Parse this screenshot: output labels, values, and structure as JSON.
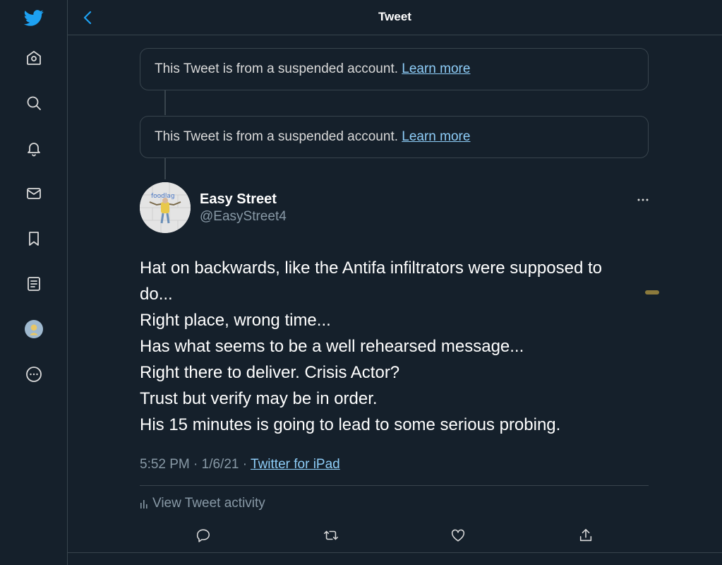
{
  "header": {
    "title": "Tweet"
  },
  "sidebar": {
    "items": [
      {
        "icon": "twitter-bird-icon"
      },
      {
        "icon": "home-icon"
      },
      {
        "icon": "search-icon"
      },
      {
        "icon": "bell-icon"
      },
      {
        "icon": "mail-icon"
      },
      {
        "icon": "bookmark-icon"
      },
      {
        "icon": "list-icon"
      },
      {
        "icon": "profile-avatar"
      },
      {
        "icon": "more-icon"
      }
    ]
  },
  "suspended_notices": [
    {
      "text": "This Tweet is from a suspended account. ",
      "link": "Learn more"
    },
    {
      "text": "This Tweet is from a suspended account. ",
      "link": "Learn more"
    }
  ],
  "tweet": {
    "display_name": "Easy Street",
    "handle": "@EasyStreet4",
    "avatar_text": "foodlag",
    "lines": [
      "Hat on backwards, like the Antifa infiltrators were supposed to",
      "do...",
      "Right place, wrong time...",
      "Has what seems to be a well rehearsed message...",
      "Right there to deliver. Crisis Actor?",
      "Trust but verify may be in order.",
      "His 15 minutes is going to lead to some serious probing."
    ],
    "timestamp": "5:52 PM · 1/6/21 · ",
    "source": "Twitter for iPad",
    "activity_label": "View Tweet activity"
  },
  "actions": [
    {
      "icon": "reply-icon"
    },
    {
      "icon": "retweet-icon"
    },
    {
      "icon": "like-icon"
    },
    {
      "icon": "share-icon"
    }
  ],
  "colors": {
    "background": "#15202b",
    "border": "#38444d",
    "link": "#8ecdf8",
    "secondary_text": "#8899a6",
    "brand": "#1da1f2"
  }
}
